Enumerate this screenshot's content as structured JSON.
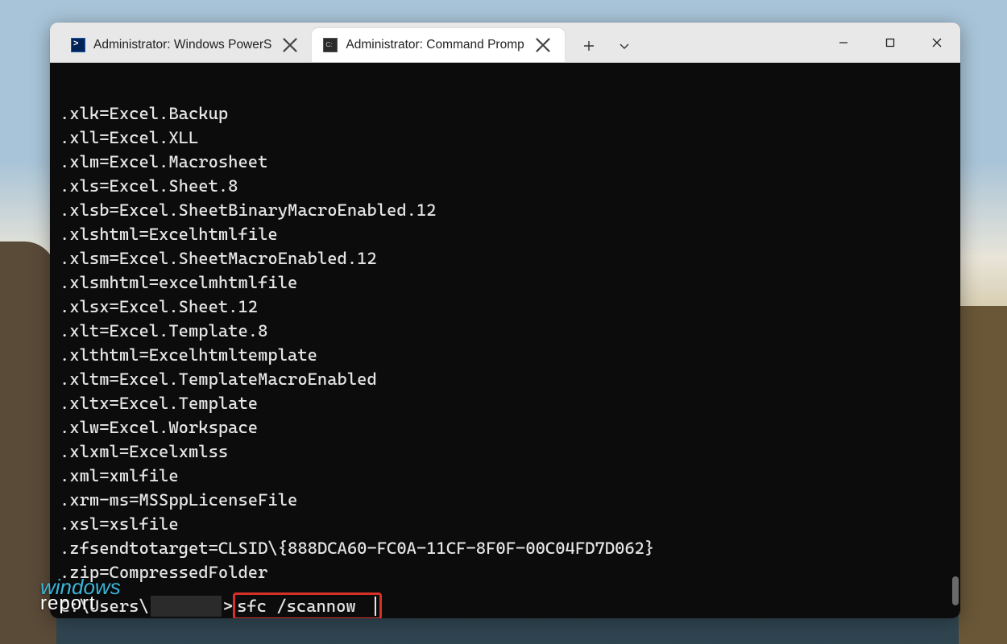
{
  "tabs": [
    {
      "label": "Administrator: Windows PowerS",
      "icon": "powershell"
    },
    {
      "label": "Administrator: Command Promp",
      "icon": "cmd"
    }
  ],
  "active_tab_index": 1,
  "terminal_output": [
    ".xlk=Excel.Backup",
    ".xll=Excel.XLL",
    ".xlm=Excel.Macrosheet",
    ".xls=Excel.Sheet.8",
    ".xlsb=Excel.SheetBinaryMacroEnabled.12",
    ".xlshtml=Excelhtmlfile",
    ".xlsm=Excel.SheetMacroEnabled.12",
    ".xlsmhtml=excelmhtmlfile",
    ".xlsx=Excel.Sheet.12",
    ".xlt=Excel.Template.8",
    ".xlthtml=Excelhtmltemplate",
    ".xltm=Excel.TemplateMacroEnabled",
    ".xltx=Excel.Template",
    ".xlw=Excel.Workspace",
    ".xlxml=Excelxmlss",
    ".xml=xmlfile",
    ".xrm-ms=MSSppLicenseFile",
    ".xsl=xslfile",
    ".zfsendtotarget=CLSID\\{888DCA60-FC0A-11CF-8F0F-00C04FD7D062}",
    ".zip=CompressedFolder"
  ],
  "prompt": {
    "prefix": "C:\\Users\\",
    "suffix": ">",
    "command": "sfc /scannow"
  },
  "watermark": {
    "line1": "windows",
    "line2": "report"
  }
}
